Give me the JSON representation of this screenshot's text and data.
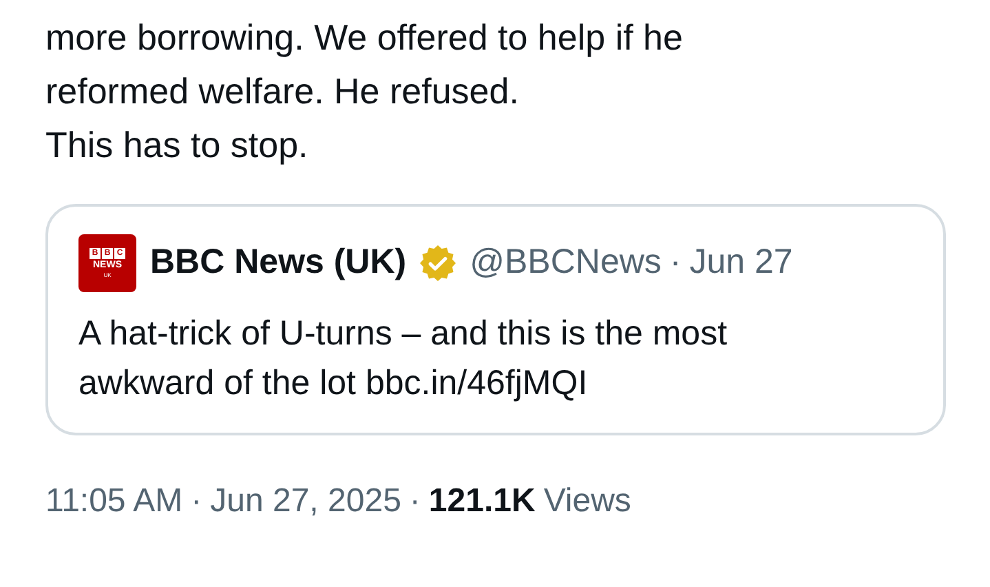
{
  "tweet": {
    "text_lines": [
      "more borrowing. We offered to help if he",
      "reformed welfare. He refused.",
      "This has to stop."
    ]
  },
  "quote": {
    "avatar": {
      "blocks": [
        "B",
        "B",
        "C"
      ],
      "line1": "NEWS",
      "line2": "UK"
    },
    "name": "BBC News (UK)",
    "verified": true,
    "handle": "@BBCNews",
    "separator": "·",
    "date": "Jun 27",
    "text": "A hat-trick of U-turns – and this is the most awkward of the lot",
    "link": "bbc.in/46fjMQI"
  },
  "footer": {
    "time": "11:05 AM",
    "separator_1": "·",
    "date": "Jun 27, 2025",
    "separator_2": "·",
    "views_count": "121.1K",
    "views_label": "Views"
  }
}
